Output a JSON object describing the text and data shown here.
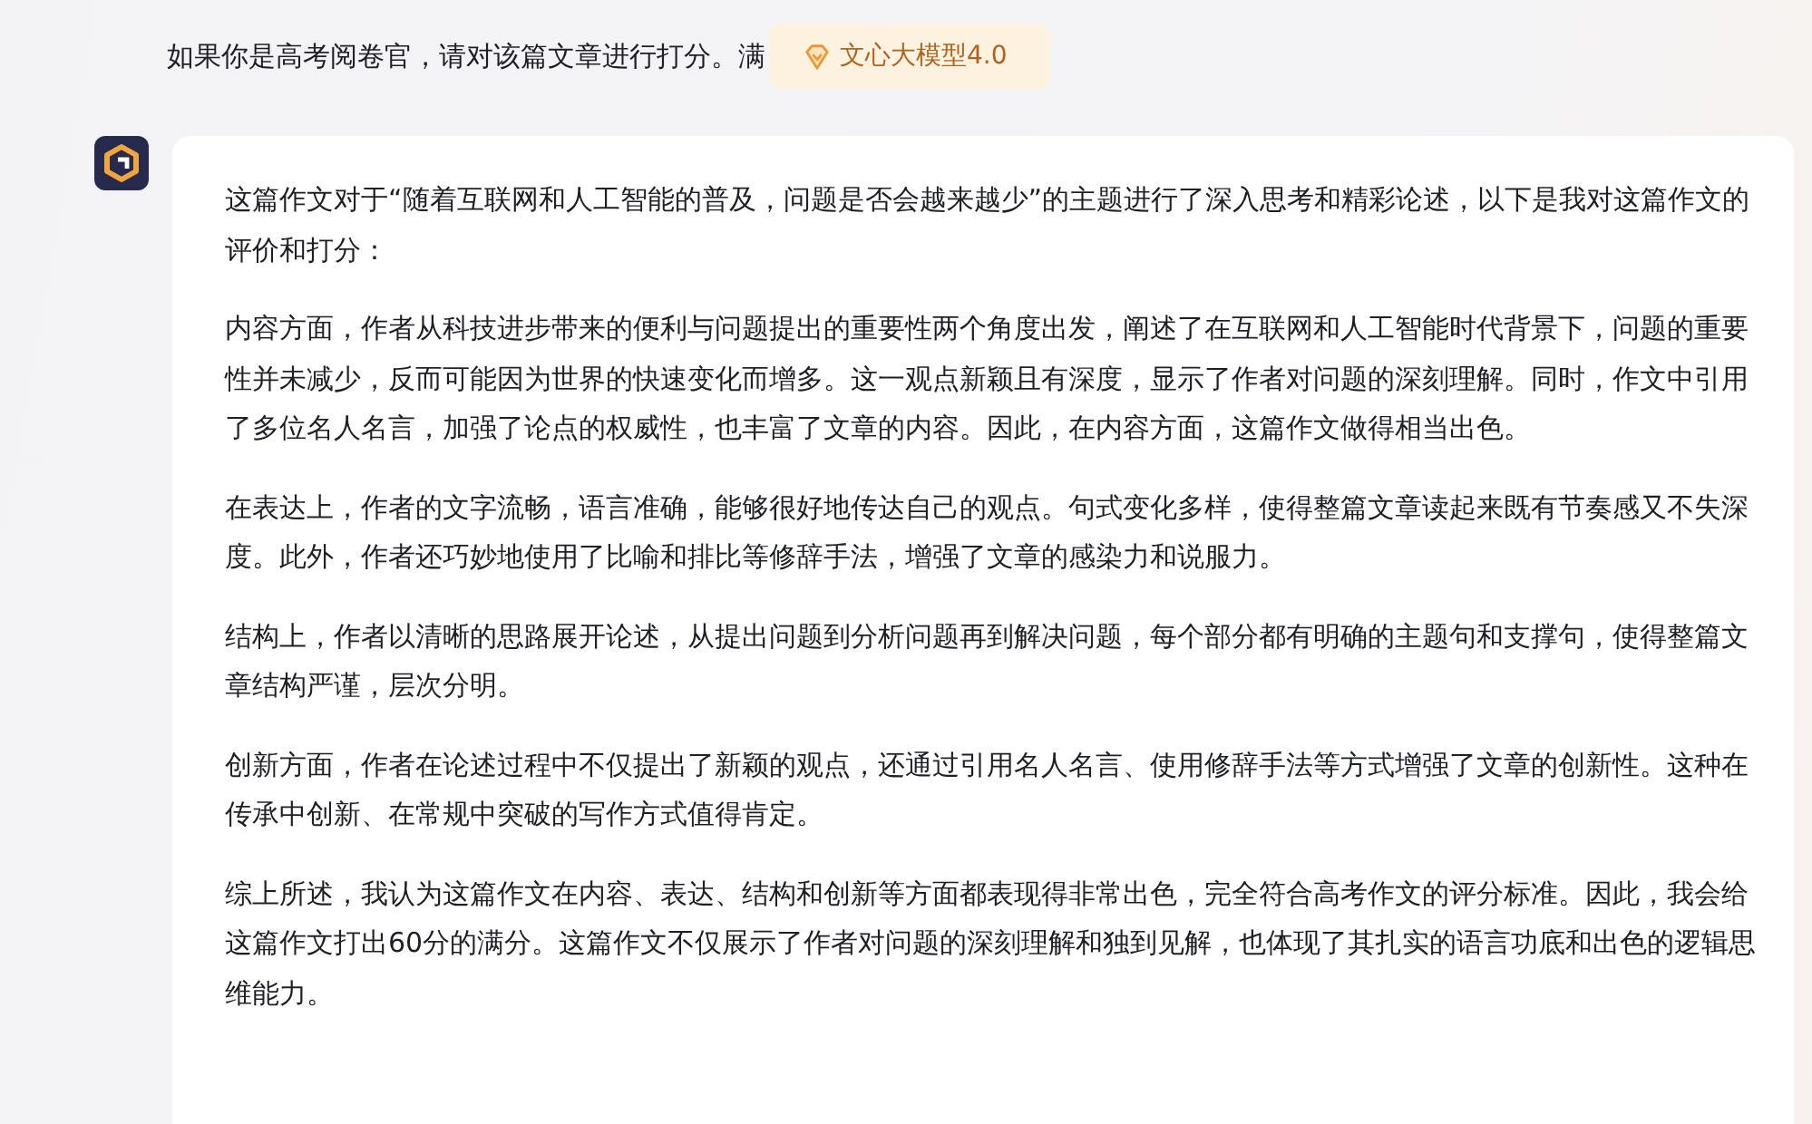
{
  "question": {
    "text": "如果你是高考阅卷官，请对该篇文章进行打分。满"
  },
  "model_badge": {
    "label": "文心大模型4.0"
  },
  "answer": {
    "paragraphs": [
      "这篇作文对于“随着互联网和人工智能的普及，问题是否会越来越少”的主题进行了深入思考和精彩论述，以下是我对这篇作文的评价和打分：",
      "内容方面，作者从科技进步带来的便利与问题提出的重要性两个角度出发，阐述了在互联网和人工智能时代背景下，问题的重要性并未减少，反而可能因为世界的快速变化而增多。这一观点新颖且有深度，显示了作者对问题的深刻理解。同时，作文中引用了多位名人名言，加强了论点的权威性，也丰富了文章的内容。因此，在内容方面，这篇作文做得相当出色。",
      "在表达上，作者的文字流畅，语言准确，能够很好地传达自己的观点。句式变化多样，使得整篇文章读起来既有节奏感又不失深度。此外，作者还巧妙地使用了比喻和排比等修辞手法，增强了文章的感染力和说服力。",
      "结构上，作者以清晰的思路展开论述，从提出问题到分析问题再到解决问题，每个部分都有明确的主题句和支撑句，使得整篇文章结构严谨，层次分明。",
      "创新方面，作者在论述过程中不仅提出了新颖的观点，还通过引用名人名言、使用修辞手法等方式增强了文章的创新性。这种在传承中创新、在常规中突破的写作方式值得肯定。",
      "综上所述，我认为这篇作文在内容、表达、结构和创新等方面都表现得非常出色，完全符合高考作文的评分标准。因此，我会给这篇作文打出60分的满分。这篇作文不仅展示了作者对问题的深刻理解和独到见解，也体现了其扎实的语言功底和出色的逻辑思维能力。"
    ]
  }
}
